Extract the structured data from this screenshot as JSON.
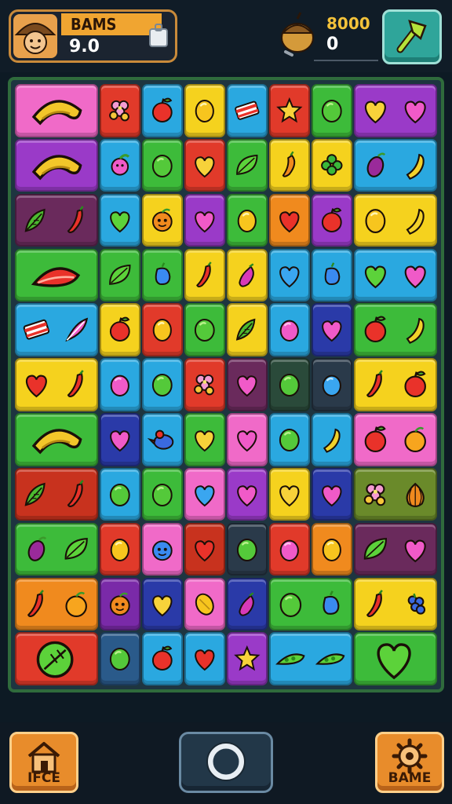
{
  "header": {
    "player_name": "BAMS",
    "player_score": "9.0",
    "target_label": "8000",
    "current_score": "0",
    "avatar_icon": "explorer-avatar-icon",
    "bag_icon": "bag-icon",
    "coin_icon": "acorn-coin-icon",
    "boost_icon": "hammer-boost-icon"
  },
  "footer": {
    "home_label": "IFCE",
    "center_icon": "ring-button-icon",
    "game_label": "BAME"
  },
  "board": {
    "rows": 11,
    "tiles": [
      {
        "r": 0,
        "c": 0,
        "span": 2,
        "bg": "#f06ac8",
        "f": "banana"
      },
      {
        "r": 0,
        "c": 2,
        "bg": "#e13a2a",
        "f": "flower"
      },
      {
        "r": 0,
        "c": 3,
        "bg": "#2aa8e0",
        "f": "apple"
      },
      {
        "r": 0,
        "c": 4,
        "bg": "#f5d21e",
        "f": "lemon"
      },
      {
        "r": 0,
        "c": 5,
        "bg": "#2aa8e0",
        "f": "candy"
      },
      {
        "r": 0,
        "c": 6,
        "bg": "#e13a2a",
        "f": "star"
      },
      {
        "r": 0,
        "c": 7,
        "bg": "#3dbb3a",
        "f": "lime"
      },
      {
        "r": 0,
        "c": 8,
        "span": 2,
        "bg": "#9a3ac8",
        "f": "heart",
        "f2": "heartpink"
      },
      {
        "r": 1,
        "c": 0,
        "span": 2,
        "bg": "#9a3ac8",
        "f": "banana"
      },
      {
        "r": 1,
        "c": 2,
        "bg": "#2aa8e0",
        "f": "berry"
      },
      {
        "r": 1,
        "c": 3,
        "bg": "#3dbb3a",
        "f": "lime"
      },
      {
        "r": 1,
        "c": 4,
        "bg": "#e13a2a",
        "f": "heart"
      },
      {
        "r": 1,
        "c": 5,
        "bg": "#3dbb3a",
        "f": "leaf"
      },
      {
        "r": 1,
        "c": 6,
        "bg": "#f5d21e",
        "f": "pepper"
      },
      {
        "r": 1,
        "c": 7,
        "bg": "#f5d21e",
        "f": "clover"
      },
      {
        "r": 1,
        "c": 8,
        "span": 2,
        "bg": "#2aa8e0",
        "f": "plum",
        "f2": "banana2"
      },
      {
        "r": 2,
        "c": 0,
        "span": 2,
        "bg": "#6a2a5c",
        "f": "leafy",
        "f2": "chili"
      },
      {
        "r": 2,
        "c": 2,
        "bg": "#2aa8e0",
        "f": "heartgreen"
      },
      {
        "r": 2,
        "c": 3,
        "bg": "#f5d21e",
        "f": "orangeface"
      },
      {
        "r": 2,
        "c": 4,
        "bg": "#9a3ac8",
        "f": "heartpink"
      },
      {
        "r": 2,
        "c": 5,
        "bg": "#3dbb3a",
        "f": "lemon"
      },
      {
        "r": 2,
        "c": 6,
        "bg": "#f08a1e",
        "f": "heartred"
      },
      {
        "r": 2,
        "c": 7,
        "bg": "#9a3ac8",
        "f": "apple"
      },
      {
        "r": 2,
        "c": 8,
        "span": 2,
        "bg": "#f5d21e",
        "f": "lemon",
        "f2": "banana2"
      },
      {
        "r": 3,
        "c": 0,
        "span": 2,
        "bg": "#3dbb3a",
        "f": "melon"
      },
      {
        "r": 3,
        "c": 2,
        "bg": "#3dbb3a",
        "f": "leaf"
      },
      {
        "r": 3,
        "c": 3,
        "bg": "#3dbb3a",
        "f": "bluepepper"
      },
      {
        "r": 3,
        "c": 4,
        "bg": "#f5d21e",
        "f": "chili"
      },
      {
        "r": 3,
        "c": 5,
        "bg": "#f5d21e",
        "f": "eggplant"
      },
      {
        "r": 3,
        "c": 6,
        "bg": "#2aa8e0",
        "f": "heartblue"
      },
      {
        "r": 3,
        "c": 7,
        "bg": "#2aa8e0",
        "f": "bluepepper"
      },
      {
        "r": 3,
        "c": 8,
        "span": 2,
        "bg": "#2aa8e0",
        "f": "heartgreen",
        "f2": "heartpink"
      },
      {
        "r": 4,
        "c": 0,
        "span": 2,
        "bg": "#2aa8e0",
        "f": "candy",
        "f2": "feather"
      },
      {
        "r": 4,
        "c": 2,
        "bg": "#f5d21e",
        "f": "apple"
      },
      {
        "r": 4,
        "c": 3,
        "bg": "#e13a2a",
        "f": "lemon"
      },
      {
        "r": 4,
        "c": 4,
        "bg": "#3dbb3a",
        "f": "lime"
      },
      {
        "r": 4,
        "c": 5,
        "bg": "#f5d21e",
        "f": "leafy"
      },
      {
        "r": 4,
        "c": 6,
        "bg": "#2aa8e0",
        "f": "pinkball"
      },
      {
        "r": 4,
        "c": 7,
        "bg": "#2a3aa8",
        "f": "heartpink"
      },
      {
        "r": 4,
        "c": 8,
        "span": 2,
        "bg": "#3dbb3a",
        "f": "apple",
        "f2": "banana2"
      },
      {
        "r": 5,
        "c": 0,
        "span": 2,
        "bg": "#f5d21e",
        "f": "heartred",
        "f2": "chili"
      },
      {
        "r": 5,
        "c": 2,
        "bg": "#2aa8e0",
        "f": "pinkball"
      },
      {
        "r": 5,
        "c": 3,
        "bg": "#2aa8e0",
        "f": "lime"
      },
      {
        "r": 5,
        "c": 4,
        "bg": "#e13a2a",
        "f": "flower"
      },
      {
        "r": 5,
        "c": 5,
        "bg": "#6a2a5c",
        "f": "heartpink"
      },
      {
        "r": 5,
        "c": 6,
        "bg": "#2a4a3a",
        "f": "lime"
      },
      {
        "r": 5,
        "c": 7,
        "bg": "#2a3a4a",
        "f": "blueball"
      },
      {
        "r": 5,
        "c": 8,
        "span": 2,
        "bg": "#f5d21e",
        "f": "chili",
        "f2": "apple"
      },
      {
        "r": 6,
        "c": 0,
        "span": 2,
        "bg": "#3dbb3a",
        "f": "banana"
      },
      {
        "r": 6,
        "c": 2,
        "bg": "#2a3aa8",
        "f": "heartpink"
      },
      {
        "r": 6,
        "c": 3,
        "bg": "#2aa8e0",
        "f": "bluebird"
      },
      {
        "r": 6,
        "c": 4,
        "bg": "#3dbb3a",
        "f": "heart"
      },
      {
        "r": 6,
        "c": 5,
        "bg": "#f06ac8",
        "f": "heartpink"
      },
      {
        "r": 6,
        "c": 6,
        "bg": "#2aa8e0",
        "f": "lime"
      },
      {
        "r": 6,
        "c": 7,
        "bg": "#2aa8e0",
        "f": "banana2"
      },
      {
        "r": 6,
        "c": 8,
        "span": 2,
        "bg": "#f06ac8",
        "f": "apple",
        "f2": "orange"
      },
      {
        "r": 7,
        "c": 0,
        "span": 2,
        "bg": "#c8321e",
        "f": "leafy",
        "f2": "chili"
      },
      {
        "r": 7,
        "c": 2,
        "bg": "#2aa8e0",
        "f": "lime"
      },
      {
        "r": 7,
        "c": 3,
        "bg": "#3dbb3a",
        "f": "lime"
      },
      {
        "r": 7,
        "c": 4,
        "bg": "#f06ac8",
        "f": "heartblue"
      },
      {
        "r": 7,
        "c": 5,
        "bg": "#9a3ac8",
        "f": "heartpink"
      },
      {
        "r": 7,
        "c": 6,
        "bg": "#f5d21e",
        "f": "heart"
      },
      {
        "r": 7,
        "c": 7,
        "bg": "#2a3aa8",
        "f": "heartpink"
      },
      {
        "r": 7,
        "c": 8,
        "span": 2,
        "bg": "#6a8a2a",
        "f": "flower",
        "f2": "onion"
      },
      {
        "r": 8,
        "c": 0,
        "span": 2,
        "bg": "#3dbb3a",
        "f": "plum",
        "f2": "leaf"
      },
      {
        "r": 8,
        "c": 2,
        "bg": "#e13a2a",
        "f": "lemon"
      },
      {
        "r": 8,
        "c": 3,
        "bg": "#f06ac8",
        "f": "bluefriend"
      },
      {
        "r": 8,
        "c": 4,
        "bg": "#c8321e",
        "f": "heartred"
      },
      {
        "r": 8,
        "c": 5,
        "bg": "#2a3a4a",
        "f": "lime"
      },
      {
        "r": 8,
        "c": 6,
        "bg": "#e13a2a",
        "f": "pinkball"
      },
      {
        "r": 8,
        "c": 7,
        "bg": "#f08a1e",
        "f": "lemon"
      },
      {
        "r": 8,
        "c": 8,
        "span": 2,
        "bg": "#6a2a5c",
        "f": "leaf",
        "f2": "heartpink"
      },
      {
        "r": 9,
        "c": 0,
        "span": 2,
        "bg": "#f08a1e",
        "f": "chili",
        "f2": "orange"
      },
      {
        "r": 9,
        "c": 2,
        "bg": "#7a2aa8",
        "f": "orangeface"
      },
      {
        "r": 9,
        "c": 3,
        "bg": "#2a3aa8",
        "f": "heart"
      },
      {
        "r": 9,
        "c": 4,
        "bg": "#f06ac8",
        "f": "lemonslice"
      },
      {
        "r": 9,
        "c": 5,
        "bg": "#2a3aa8",
        "f": "eggplant"
      },
      {
        "r": 9,
        "c": 6,
        "span": 2,
        "bg": "#3dbb3a",
        "f": "lime",
        "f2": "bluepepper"
      },
      {
        "r": 9,
        "c": 8,
        "span": 2,
        "bg": "#f5d21e",
        "f": "chili",
        "f2": "grapes"
      },
      {
        "r": 10,
        "c": 0,
        "span": 2,
        "bg": "#e13a2a",
        "f": "leafball"
      },
      {
        "r": 10,
        "c": 2,
        "bg": "#2a5a8a",
        "f": "lime"
      },
      {
        "r": 10,
        "c": 3,
        "bg": "#2aa8e0",
        "f": "apple"
      },
      {
        "r": 10,
        "c": 4,
        "bg": "#2aa8e0",
        "f": "heartred",
        "f2": "feather"
      },
      {
        "r": 10,
        "c": 5,
        "bg": "#9a3ac8",
        "f": "star"
      },
      {
        "r": 10,
        "c": 6,
        "span": 2,
        "bg": "#2aa8e0",
        "f": "peas",
        "f2": "peas"
      },
      {
        "r": 10,
        "c": 8,
        "span": 2,
        "bg": "#3dbb3a",
        "f": "bigheart"
      }
    ]
  }
}
